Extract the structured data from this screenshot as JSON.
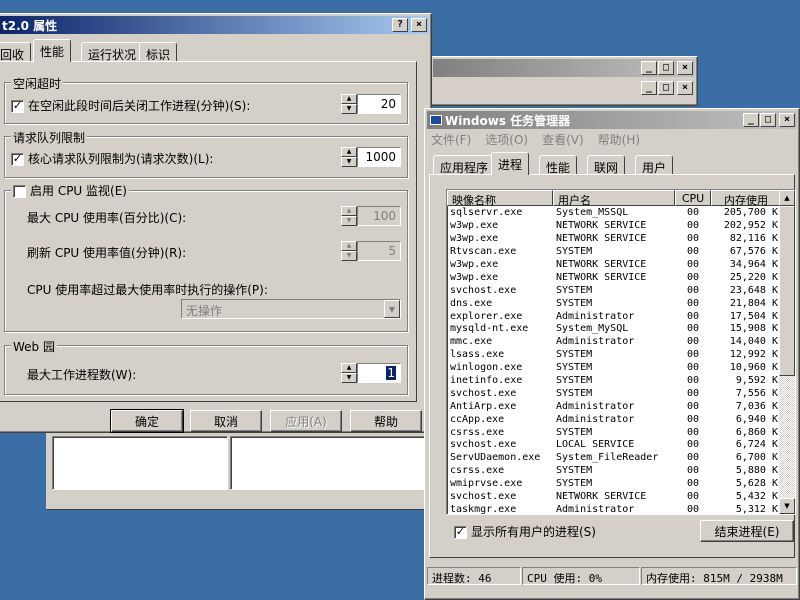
{
  "bg_window": {
    "controls": [
      "_",
      "□",
      "×"
    ]
  },
  "props": {
    "title": "t2.0 属性",
    "title_buttons": [
      "?",
      "×"
    ],
    "tabs": [
      "回收",
      "性能",
      "运行状况",
      "标识"
    ],
    "idle": {
      "title": "空闲超时",
      "checkbox_label": "在空闲此段时间后关闭工作进程(分钟)(S):",
      "value": "20"
    },
    "queue": {
      "title": "请求队列限制",
      "checkbox_label": "核心请求队列限制为(请求次数)(L):",
      "value": "1000"
    },
    "cpu": {
      "checkbox_label": "启用 CPU 监视(E)",
      "max_label": "最大 CPU 使用率(百分比)(C):",
      "max_value": "100",
      "refresh_label": "刷新 CPU 使用率值(分钟)(R):",
      "refresh_value": "5",
      "action_label": "CPU 使用率超过最大使用率时执行的操作(P):",
      "action_value": "无操作"
    },
    "web_garden": {
      "title": "Web 园",
      "max_label": "最大工作进程数(W):",
      "value": "1"
    },
    "buttons": {
      "ok": "确定",
      "cancel": "取消",
      "apply": "应用(A)",
      "help": "帮助"
    }
  },
  "taskmgr": {
    "title": "Windows 任务管理器",
    "title_buttons": [
      "_",
      "□",
      "×"
    ],
    "menu": [
      "文件(F)",
      "选项(O)",
      "查看(V)",
      "帮助(H)"
    ],
    "tabs": [
      "应用程序",
      "进程",
      "性能",
      "联网",
      "用户"
    ],
    "columns": [
      "映像名称",
      "用户名",
      "CPU",
      "内存使用"
    ],
    "rows": [
      [
        "sqlservr.exe",
        "System_MSSQL",
        "00",
        "205,700 K"
      ],
      [
        "w3wp.exe",
        "NETWORK SERVICE",
        "00",
        "202,952 K"
      ],
      [
        "w3wp.exe",
        "NETWORK SERVICE",
        "00",
        "82,116 K"
      ],
      [
        "Rtvscan.exe",
        "SYSTEM",
        "00",
        "67,576 K"
      ],
      [
        "w3wp.exe",
        "NETWORK SERVICE",
        "00",
        "34,964 K"
      ],
      [
        "w3wp.exe",
        "NETWORK SERVICE",
        "00",
        "25,220 K"
      ],
      [
        "svchost.exe",
        "SYSTEM",
        "00",
        "23,648 K"
      ],
      [
        "dns.exe",
        "SYSTEM",
        "00",
        "21,804 K"
      ],
      [
        "explorer.exe",
        "Administrator",
        "00",
        "17,504 K"
      ],
      [
        "mysqld-nt.exe",
        "System_MySQL",
        "00",
        "15,908 K"
      ],
      [
        "mmc.exe",
        "Administrator",
        "00",
        "14,040 K"
      ],
      [
        "lsass.exe",
        "SYSTEM",
        "00",
        "12,992 K"
      ],
      [
        "winlogon.exe",
        "SYSTEM",
        "00",
        "10,960 K"
      ],
      [
        "inetinfo.exe",
        "SYSTEM",
        "00",
        "9,592 K"
      ],
      [
        "svchost.exe",
        "SYSTEM",
        "00",
        "7,556 K"
      ],
      [
        "AntiArp.exe",
        "Administrator",
        "00",
        "7,036 K"
      ],
      [
        "ccApp.exe",
        "Administrator",
        "00",
        "6,940 K"
      ],
      [
        "csrss.exe",
        "SYSTEM",
        "00",
        "6,860 K"
      ],
      [
        "svchost.exe",
        "LOCAL SERVICE",
        "00",
        "6,724 K"
      ],
      [
        "ServUDaemon.exe",
        "System_FileReader",
        "00",
        "6,700 K"
      ],
      [
        "csrss.exe",
        "SYSTEM",
        "00",
        "5,880 K"
      ],
      [
        "wmiprvse.exe",
        "SYSTEM",
        "00",
        "5,628 K"
      ],
      [
        "svchost.exe",
        "NETWORK SERVICE",
        "00",
        "5,432 K"
      ],
      [
        "taskmgr.exe",
        "Administrator",
        "00",
        "5,312 K"
      ]
    ],
    "show_all_label": "显示所有用户的进程(S)",
    "end_process_label": "结束进程(E)",
    "status": {
      "processes": "进程数: 46",
      "cpu": "CPU 使用: 0%",
      "memory": "内存使用: 815M / 2938M"
    }
  }
}
